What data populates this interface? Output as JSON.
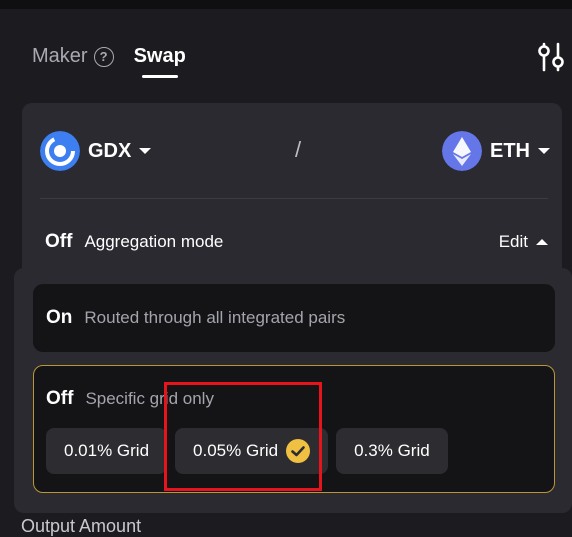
{
  "tabs": {
    "maker": "Maker",
    "swap": "Swap"
  },
  "pair": {
    "from_token": "GDX",
    "separator": "/",
    "to_token": "ETH"
  },
  "aggregation": {
    "state": "Off",
    "label": "Aggregation mode",
    "edit_label": "Edit"
  },
  "options": {
    "on": {
      "title": "On",
      "description": "Routed through all integrated pairs"
    },
    "off": {
      "title": "Off",
      "description": "Specific grid only"
    }
  },
  "grids": [
    {
      "label": "0.01% Grid",
      "selected": false
    },
    {
      "label": "0.05% Grid",
      "selected": true
    },
    {
      "label": "0.3% Grid",
      "selected": false
    }
  ],
  "output_label": "Output Amount",
  "colors": {
    "accent_border": "#b8963a",
    "check_fill": "#f0c043",
    "highlight": "#e8141b",
    "gdx_logo": "#3d7ff0",
    "eth_logo": "#6577e8"
  }
}
